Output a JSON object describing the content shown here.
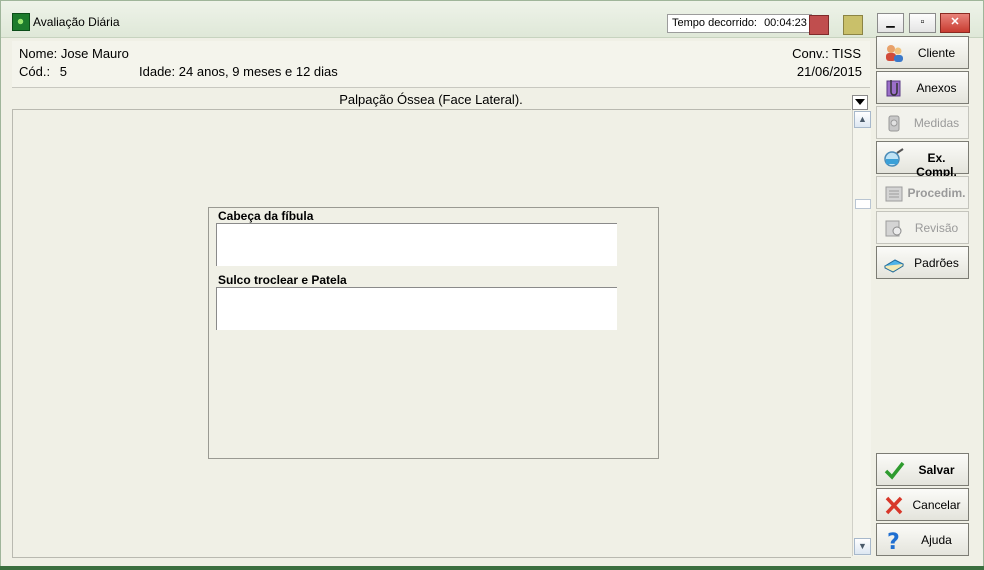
{
  "window": {
    "title": "Avaliação Diária",
    "timer_label": "Tempo decorrido:",
    "timer_value": "00:04:23"
  },
  "patient": {
    "name_label": "Nome:",
    "name": "Jose Mauro",
    "cod_label": "Cód.:",
    "cod": "5",
    "idade_label": "Idade:",
    "idade": "24 anos, 9 meses e 12 dias",
    "conv_label": "Conv.:",
    "conv": "TISS",
    "date": "21/06/2015"
  },
  "section": {
    "title": "Palpação Óssea (Face Lateral).",
    "fields": [
      {
        "label": "Cabeça da fíbula",
        "value": ""
      },
      {
        "label": "Sulco troclear e Patela",
        "value": ""
      }
    ]
  },
  "sidebar": {
    "buttons": [
      {
        "label": "Cliente",
        "icon": "people-icon",
        "enabled": true
      },
      {
        "label": "Anexos",
        "icon": "attachment-icon",
        "enabled": true
      },
      {
        "label": "Medidas",
        "icon": "measure-icon",
        "enabled": false
      },
      {
        "label": "Ex. Compl.",
        "icon": "magnifier-icon",
        "enabled": true
      },
      {
        "label": "Procedim.",
        "icon": "procedure-icon",
        "enabled": false
      },
      {
        "label": "Revisão",
        "icon": "review-icon",
        "enabled": false
      },
      {
        "label": "Padrões",
        "icon": "book-icon",
        "enabled": true
      }
    ],
    "actions": [
      {
        "label": "Salvar",
        "icon": "checkmark-icon"
      },
      {
        "label": "Cancelar",
        "icon": "x-icon"
      },
      {
        "label": "Ajuda",
        "icon": "question-icon"
      }
    ]
  },
  "colors": {
    "accent_green": "#1d7b2d",
    "stop_red": "#c04e4e",
    "pause_yellow": "#c9c06a"
  }
}
